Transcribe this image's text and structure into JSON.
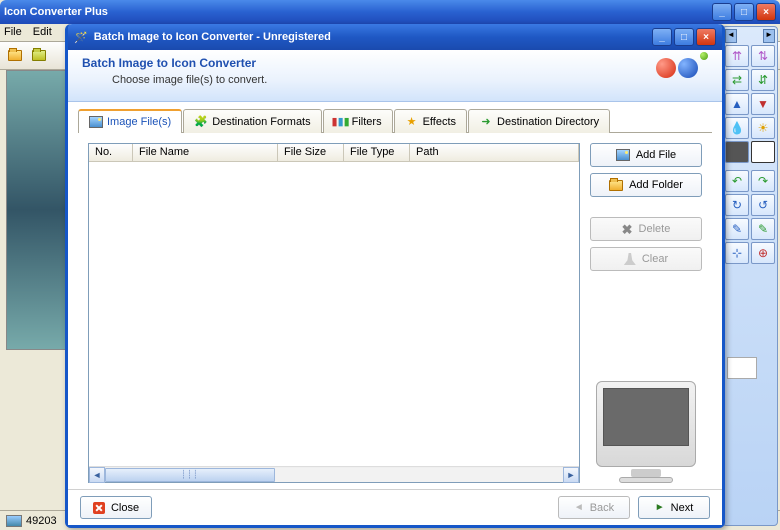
{
  "parent": {
    "title": "Icon Converter Plus",
    "menu": {
      "file": "File",
      "edit": "Edit"
    },
    "status_coords": "49203"
  },
  "dialog": {
    "title": "Batch Image to Icon Converter - Unregistered",
    "header_title": "Batch Image to Icon Converter",
    "header_sub": "Choose image file(s) to convert.",
    "tabs": {
      "image_files": "Image File(s)",
      "dest_formats": "Destination Formats",
      "filters": "Filters",
      "effects": "Effects",
      "dest_dir": "Destination Directory"
    },
    "columns": {
      "no": "No.",
      "filename": "File Name",
      "filesize": "File Size",
      "filetype": "File Type",
      "path": "Path"
    },
    "buttons": {
      "add_file": "Add File",
      "add_folder": "Add Folder",
      "delete": "Delete",
      "clear": "Clear",
      "close": "Close",
      "back": "Back",
      "next": "Next"
    }
  },
  "palette": {
    "tools": [
      "↑↓",
      "↕",
      "⇆",
      "↔",
      "▲",
      "▼",
      "💧",
      "☀",
      "◧",
      "◨",
      "◐",
      "◑",
      "↻",
      "↺",
      "✎",
      "✐",
      "⊕",
      "⊗"
    ]
  }
}
